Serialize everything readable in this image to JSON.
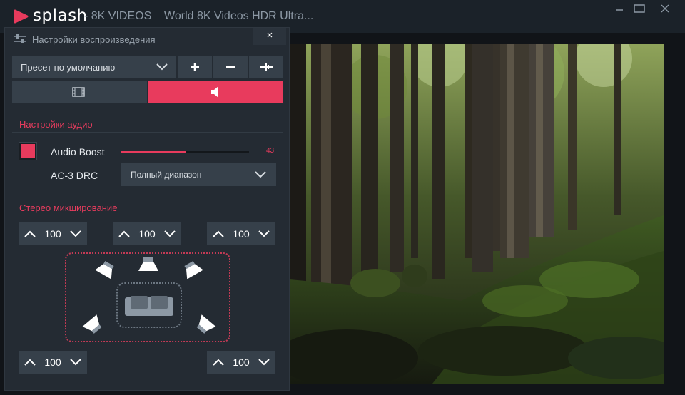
{
  "app": {
    "logo_text": "splash",
    "window_title": "-  8K VIDEOS _ World 8K Videos HDR Ultra...",
    "accent_color": "#e83b5d"
  },
  "window_controls": [
    "minimize-icon",
    "maximize-icon",
    "close-icon"
  ],
  "panel": {
    "title": "Настройки воспроизведения",
    "close_label": "×",
    "preset": {
      "selected": "Пресет по умолчанию"
    },
    "tools": [
      "plus-icon",
      "minus-icon",
      "reset-icon"
    ],
    "tabs": [
      {
        "icon": "film-icon",
        "active": false
      },
      {
        "icon": "speaker-icon",
        "active": true
      }
    ]
  },
  "audio": {
    "section_title": "Настройки аудио",
    "boost": {
      "label": "Audio Boost",
      "checked": true,
      "value": "43",
      "fraction": 0.5
    },
    "drc": {
      "label": "AC-3 DRC",
      "selected": "Полный диапазон"
    }
  },
  "stereo": {
    "section_title": "Стерео микширование",
    "front_left": "100",
    "center": "100",
    "front_right": "100",
    "rear_left": "100",
    "rear_right": "100"
  }
}
